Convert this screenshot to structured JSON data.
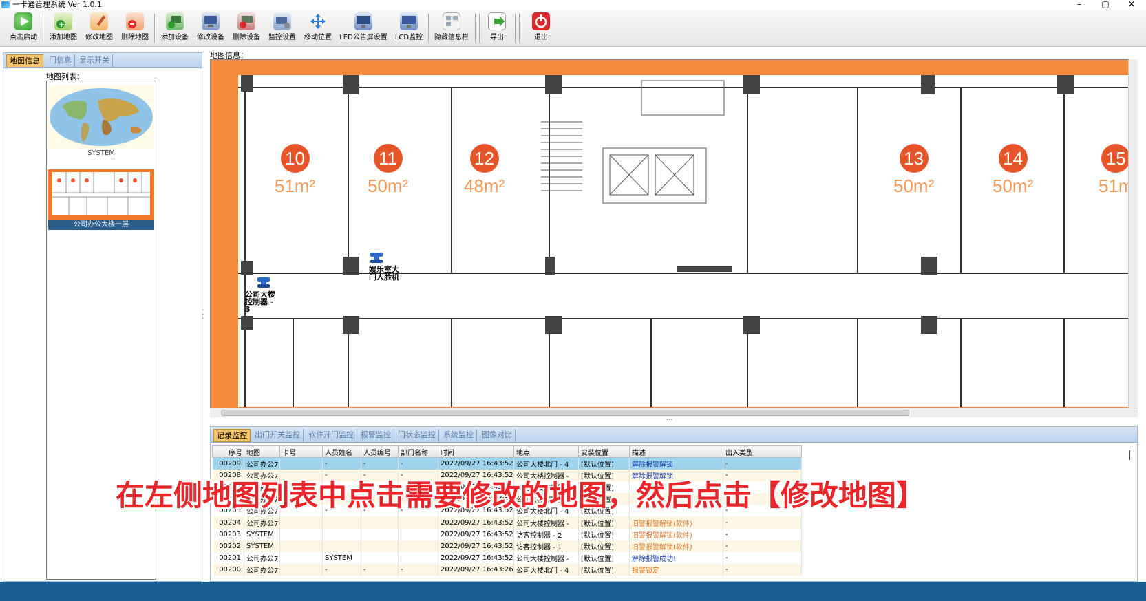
{
  "window": {
    "title": "一卡通管理系统  Ver 1.0.1",
    "controls": [
      "–",
      "▢",
      "✕"
    ]
  },
  "toolbar": {
    "buttons": [
      {
        "label": "点击启动",
        "icon": "play-icon"
      },
      {
        "label": "添加地图",
        "icon": "add-map-icon"
      },
      {
        "label": "修改地图",
        "icon": "edit-map-icon"
      },
      {
        "label": "删除地图",
        "icon": "delete-map-icon"
      },
      {
        "label": "添加设备",
        "icon": "add-device-icon"
      },
      {
        "label": "修改设备",
        "icon": "edit-device-icon"
      },
      {
        "label": "删除设备",
        "icon": "delete-device-icon"
      },
      {
        "label": "监控设置",
        "icon": "monitor-settings-icon"
      },
      {
        "label": "移动位置",
        "icon": "move-icon"
      },
      {
        "label": "LED公告屏设置",
        "icon": "led-icon"
      },
      {
        "label": "LCD监控",
        "icon": "lcd-icon"
      },
      {
        "label": "隐藏信息栏",
        "icon": "hide-panel-icon"
      },
      {
        "label": "导出",
        "icon": "export-icon"
      },
      {
        "label": "退出",
        "icon": "power-icon"
      }
    ]
  },
  "left_panel": {
    "tabs": [
      "地图信息",
      "门信息",
      "显示开关"
    ],
    "maplist_label": "地图列表：",
    "maps": [
      {
        "caption": "SYSTEM"
      },
      {
        "caption": "公司办公大楼一层"
      }
    ]
  },
  "map_area": {
    "label": "地图信息：",
    "rooms": [
      {
        "number": "10",
        "area": "51m²"
      },
      {
        "number": "11",
        "area": "50m²"
      },
      {
        "number": "12",
        "area": "48m²"
      },
      {
        "number": "13",
        "area": "50m²"
      },
      {
        "number": "14",
        "area": "50m²"
      },
      {
        "number": "15",
        "area": "51m"
      }
    ],
    "devices": [
      {
        "label": "娱乐室大\n门人脸机"
      },
      {
        "label": "公司大楼\n控制器 -\n3"
      }
    ]
  },
  "bottom_panel": {
    "tabs": [
      "记录监控",
      "出门开关监控",
      "软件开门监控",
      "报警监控",
      "门状态监控",
      "系统监控",
      "图像对比"
    ],
    "columns": [
      "序号",
      "地图",
      "卡号",
      "人员姓名",
      "人员编号",
      "部门名称",
      "时间",
      "地点",
      "安装位置",
      "描述",
      "出入类型"
    ],
    "rows": [
      {
        "no": "00209",
        "map": "公司办公7",
        "card": "",
        "name": "-",
        "pid": "-",
        "dept": "-",
        "time": "2022/09/27 16:43:52",
        "place": "公司大楼北门 - 4",
        "pos": "[默认位置]",
        "desc": "解除报警解锁",
        "type": "-"
      },
      {
        "no": "00208",
        "map": "公司办公7",
        "card": "",
        "name": "-",
        "pid": "-",
        "dept": "-",
        "time": "2022/09/27 16:43:52",
        "place": "公司大楼控制器 -",
        "pos": "[默认位置]",
        "desc": "解除报警解锁",
        "type": "-"
      },
      {
        "no": "00207",
        "map": "公司办公7",
        "card": "",
        "name": "-",
        "pid": "-",
        "dept": "-",
        "time": "2022/09/27 16:43:52",
        "place": "公司大楼控制器 -",
        "pos": "[默认位置]",
        "desc": "",
        "type": "-"
      },
      {
        "no": "00206",
        "map": "公司办公7",
        "card": "",
        "name": "-",
        "pid": "-",
        "dept": "-",
        "time": "2022/09/27 16:43:52",
        "place": "公司大楼控制器 -",
        "pos": "[默认位置]",
        "desc": "",
        "type": "-"
      },
      {
        "no": "00205",
        "map": "公司办公7",
        "card": "",
        "name": "-",
        "pid": "-",
        "dept": "-",
        "time": "2022/09/27 16:43:52",
        "place": "公司大楼北门 - 4",
        "pos": "[默认位置]",
        "desc": "",
        "type": "-"
      },
      {
        "no": "00204",
        "map": "公司办公7",
        "card": "",
        "name": "",
        "pid": "",
        "dept": "",
        "time": "2022/09/27 16:43:52",
        "place": "公司大楼控制器 -",
        "pos": "[默认位置]",
        "desc": "旧警报警解锁(软件)",
        "type": "-"
      },
      {
        "no": "00203",
        "map": "SYSTEM",
        "card": "",
        "name": "",
        "pid": "",
        "dept": "",
        "time": "2022/09/27 16:43:52",
        "place": "访客控制器 - 2",
        "pos": "[默认位置]",
        "desc": "旧警报警解锁(软件)",
        "type": "-"
      },
      {
        "no": "00202",
        "map": "SYSTEM",
        "card": "",
        "name": "",
        "pid": "",
        "dept": "",
        "time": "2022/09/27 16:43:52",
        "place": "访客控制器 - 1",
        "pos": "[默认位置]",
        "desc": "旧警报警解锁(软件)",
        "type": "-"
      },
      {
        "no": "00201",
        "map": "公司办公7",
        "card": "",
        "name": "SYSTEM",
        "pid": "",
        "dept": "",
        "time": "2022/09/27 16:43:52",
        "place": "公司大楼控制器 -",
        "pos": "[默认位置]",
        "desc": "解除报警成功!",
        "type": "-"
      },
      {
        "no": "00200",
        "map": "公司办公7",
        "card": "",
        "name": "-",
        "pid": "-",
        "dept": "-",
        "time": "2022/09/27 16:43:26",
        "place": "公司大楼北门 - 4",
        "pos": "[默认位置]",
        "desc": "报警锁定",
        "type": "-"
      }
    ]
  },
  "subtitle": "在左侧地图列表中点击需要修改的地图，然后点击【修改地图】",
  "colors": {
    "accent": "#1b5d8e",
    "map_bg": "#f58a3a",
    "room_number": "#e8542a",
    "desc_blue": "#1a3fb0",
    "desc_orange": "#e07a2a",
    "subtitle": "#e8262a"
  }
}
